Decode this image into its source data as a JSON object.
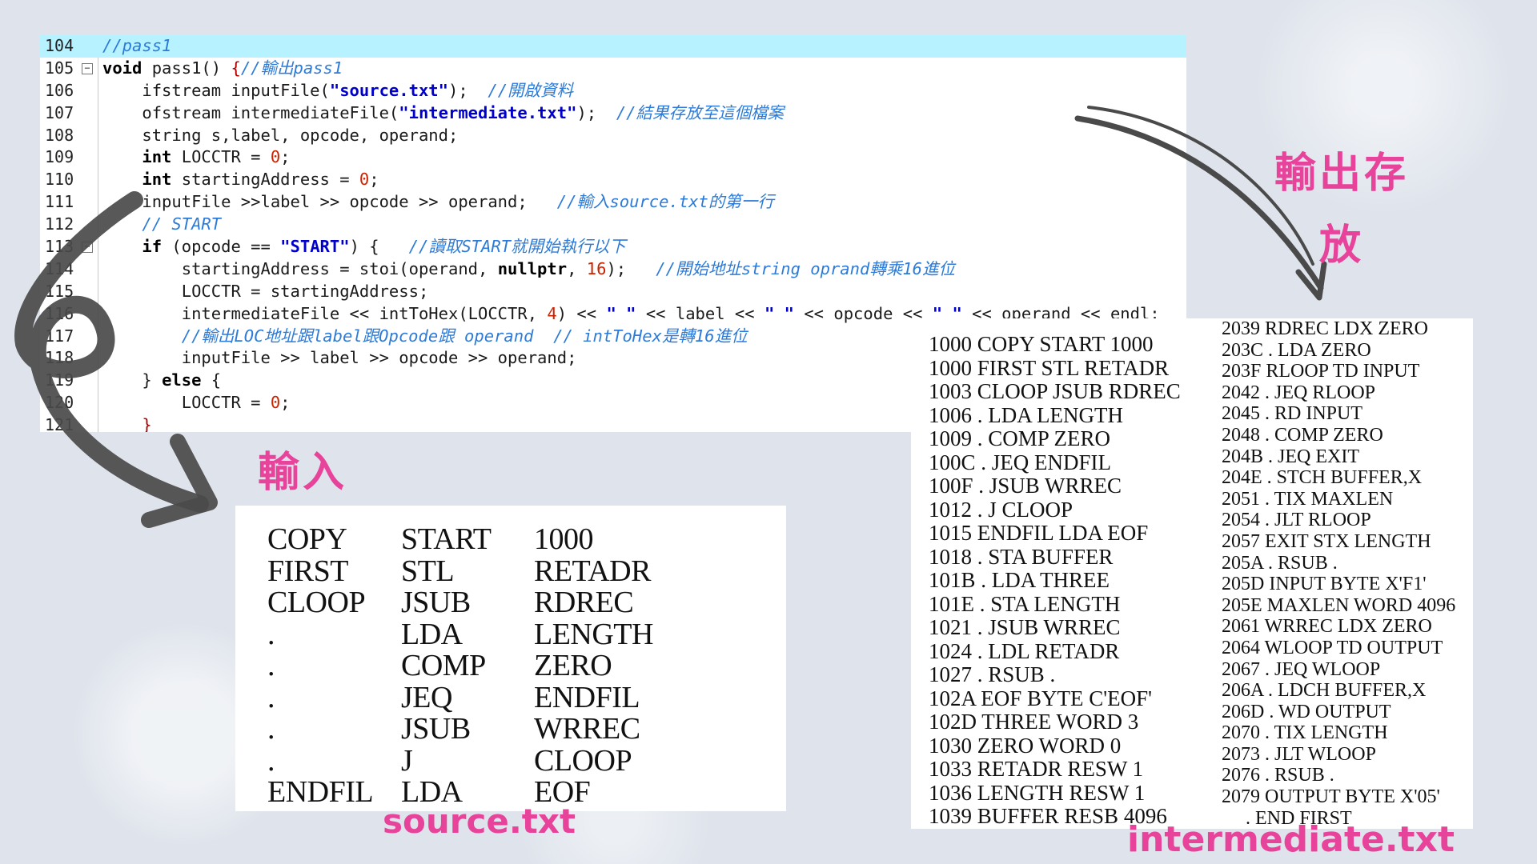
{
  "code": {
    "lines": [
      {
        "num": "104",
        "fold": "",
        "current": true,
        "parts": [
          {
            "t": "c",
            "v": "//pass1"
          }
        ]
      },
      {
        "num": "105",
        "fold": "−",
        "parts": [
          {
            "t": "k",
            "v": "void"
          },
          {
            "t": "p",
            "v": " pass1() "
          },
          {
            "t": "o",
            "v": "{"
          },
          {
            "t": "c",
            "v": "//輸出pass1"
          }
        ]
      },
      {
        "num": "106",
        "fold": "",
        "parts": [
          {
            "t": "p",
            "v": "    ifstream inputFile("
          },
          {
            "t": "s",
            "v": "\"source.txt\""
          },
          {
            "t": "p",
            "v": ");  "
          },
          {
            "t": "c",
            "v": "//開啟資料"
          }
        ]
      },
      {
        "num": "107",
        "fold": "",
        "parts": [
          {
            "t": "p",
            "v": "    ofstream intermediateFile("
          },
          {
            "t": "s",
            "v": "\"intermediate.txt\""
          },
          {
            "t": "p",
            "v": ");  "
          },
          {
            "t": "c",
            "v": "//結果存放至這個檔案"
          }
        ]
      },
      {
        "num": "108",
        "fold": "",
        "parts": [
          {
            "t": "p",
            "v": "    string s,label, opcode, operand;"
          }
        ]
      },
      {
        "num": "109",
        "fold": "",
        "parts": [
          {
            "t": "k",
            "v": "    int"
          },
          {
            "t": "p",
            "v": " LOCCTR = "
          },
          {
            "t": "n",
            "v": "0"
          },
          {
            "t": "p",
            "v": ";"
          }
        ]
      },
      {
        "num": "110",
        "fold": "",
        "parts": [
          {
            "t": "k",
            "v": "    int"
          },
          {
            "t": "p",
            "v": " startingAddress = "
          },
          {
            "t": "n",
            "v": "0"
          },
          {
            "t": "p",
            "v": ";"
          }
        ]
      },
      {
        "num": "111",
        "fold": "",
        "parts": [
          {
            "t": "p",
            "v": "    inputFile >>label >> opcode >> operand;   "
          },
          {
            "t": "c",
            "v": "//輸入source.txt的第一行"
          }
        ]
      },
      {
        "num": "112",
        "fold": "",
        "parts": [
          {
            "t": "c",
            "v": "    // START"
          }
        ]
      },
      {
        "num": "113",
        "fold": "−",
        "parts": [
          {
            "t": "k",
            "v": "    if"
          },
          {
            "t": "p",
            "v": " (opcode == "
          },
          {
            "t": "s",
            "v": "\"START\""
          },
          {
            "t": "p",
            "v": ") {   "
          },
          {
            "t": "c",
            "v": "//讀取START就開始執行以下"
          }
        ]
      },
      {
        "num": "114",
        "fold": "",
        "parts": [
          {
            "t": "p",
            "v": "        startingAddress = stoi(operand, "
          },
          {
            "t": "k",
            "v": "nullptr"
          },
          {
            "t": "p",
            "v": ", "
          },
          {
            "t": "n",
            "v": "16"
          },
          {
            "t": "p",
            "v": ");   "
          },
          {
            "t": "c",
            "v": "//開始地址string oprand轉乘16進位"
          }
        ]
      },
      {
        "num": "115",
        "fold": "",
        "parts": [
          {
            "t": "p",
            "v": "        LOCCTR = startingAddress;"
          }
        ]
      },
      {
        "num": "116",
        "fold": "",
        "parts": [
          {
            "t": "p",
            "v": "        intermediateFile << intToHex(LOCCTR, "
          },
          {
            "t": "n",
            "v": "4"
          },
          {
            "t": "p",
            "v": ") << "
          },
          {
            "t": "s",
            "v": "\" \""
          },
          {
            "t": "p",
            "v": " << label << "
          },
          {
            "t": "s",
            "v": "\" \""
          },
          {
            "t": "p",
            "v": " << opcode << "
          },
          {
            "t": "s",
            "v": "\" \""
          },
          {
            "t": "p",
            "v": " << operand << endl;"
          }
        ]
      },
      {
        "num": "117",
        "fold": "",
        "parts": [
          {
            "t": "c",
            "v": "        //輸出LOC地址跟label跟Opcode跟 operand  // intToHex是轉16進位"
          }
        ]
      },
      {
        "num": "118",
        "fold": "",
        "parts": [
          {
            "t": "p",
            "v": "        inputFile >> label >> opcode >> operand;"
          }
        ]
      },
      {
        "num": "119",
        "fold": "",
        "parts": [
          {
            "t": "p",
            "v": "    } "
          },
          {
            "t": "k",
            "v": "else"
          },
          {
            "t": "p",
            "v": " {"
          }
        ]
      },
      {
        "num": "120",
        "fold": "",
        "parts": [
          {
            "t": "p",
            "v": "        LOCCTR = "
          },
          {
            "t": "n",
            "v": "0"
          },
          {
            "t": "p",
            "v": ";"
          }
        ]
      },
      {
        "num": "121",
        "fold": "",
        "parts": [
          {
            "t": "o",
            "v": "    }"
          }
        ]
      }
    ]
  },
  "labels": {
    "input": "輸入",
    "output": "輸出存放",
    "source_file": "source.txt",
    "intermediate_file": "intermediate.txt"
  },
  "source_rows": [
    [
      "COPY",
      "START",
      "1000"
    ],
    [
      "FIRST",
      "STL",
      "RETADR"
    ],
    [
      "CLOOP",
      "JSUB",
      "RDREC"
    ],
    [
      ".",
      "LDA",
      "LENGTH"
    ],
    [
      ".",
      "COMP",
      "ZERO"
    ],
    [
      ".",
      "JEQ",
      "ENDFIL"
    ],
    [
      ".",
      "JSUB",
      "WRREC"
    ],
    [
      ".",
      "J",
      "CLOOP"
    ],
    [
      "ENDFIL",
      "LDA",
      "EOF"
    ]
  ],
  "intermediate_left": [
    "1000 COPY START 1000",
    "1000 FIRST STL RETADR",
    "1003 CLOOP JSUB RDREC",
    "1006 . LDA LENGTH",
    "1009 . COMP ZERO",
    "100C . JEQ ENDFIL",
    "100F . JSUB WRREC",
    "1012 . J CLOOP",
    "1015 ENDFIL LDA EOF",
    "1018 . STA BUFFER",
    "101B . LDA THREE",
    "101E . STA LENGTH",
    "1021 . JSUB WRREC",
    "1024 . LDL RETADR",
    "1027 . RSUB .",
    "102A EOF BYTE C'EOF'",
    "102D THREE WORD 3",
    "1030 ZERO WORD 0",
    "1033 RETADR RESW 1",
    "1036 LENGTH RESW 1",
    "1039 BUFFER RESB 4096"
  ],
  "intermediate_right": [
    "2039 RDREC LDX ZERO",
    "203C . LDA ZERO",
    "203F RLOOP TD INPUT",
    "2042 . JEQ RLOOP",
    "2045 . RD INPUT",
    "2048 . COMP ZERO",
    "204B . JEQ EXIT",
    "204E . STCH BUFFER,X",
    "2051 . TIX MAXLEN",
    "2054 . JLT RLOOP",
    "2057 EXIT STX LENGTH",
    "205A . RSUB .",
    "205D INPUT BYTE X'F1'",
    "205E MAXLEN WORD 4096",
    "2061 WRREC LDX ZERO",
    "2064 WLOOP TD OUTPUT",
    "2067 . JEQ WLOOP",
    "206A . LDCH BUFFER,X",
    "206D . WD OUTPUT",
    "2070 . TIX LENGTH",
    "2073 . JLT WLOOP",
    "2076 . RSUB .",
    "2079 OUTPUT BYTE X'05'",
    "     . END FIRST"
  ]
}
